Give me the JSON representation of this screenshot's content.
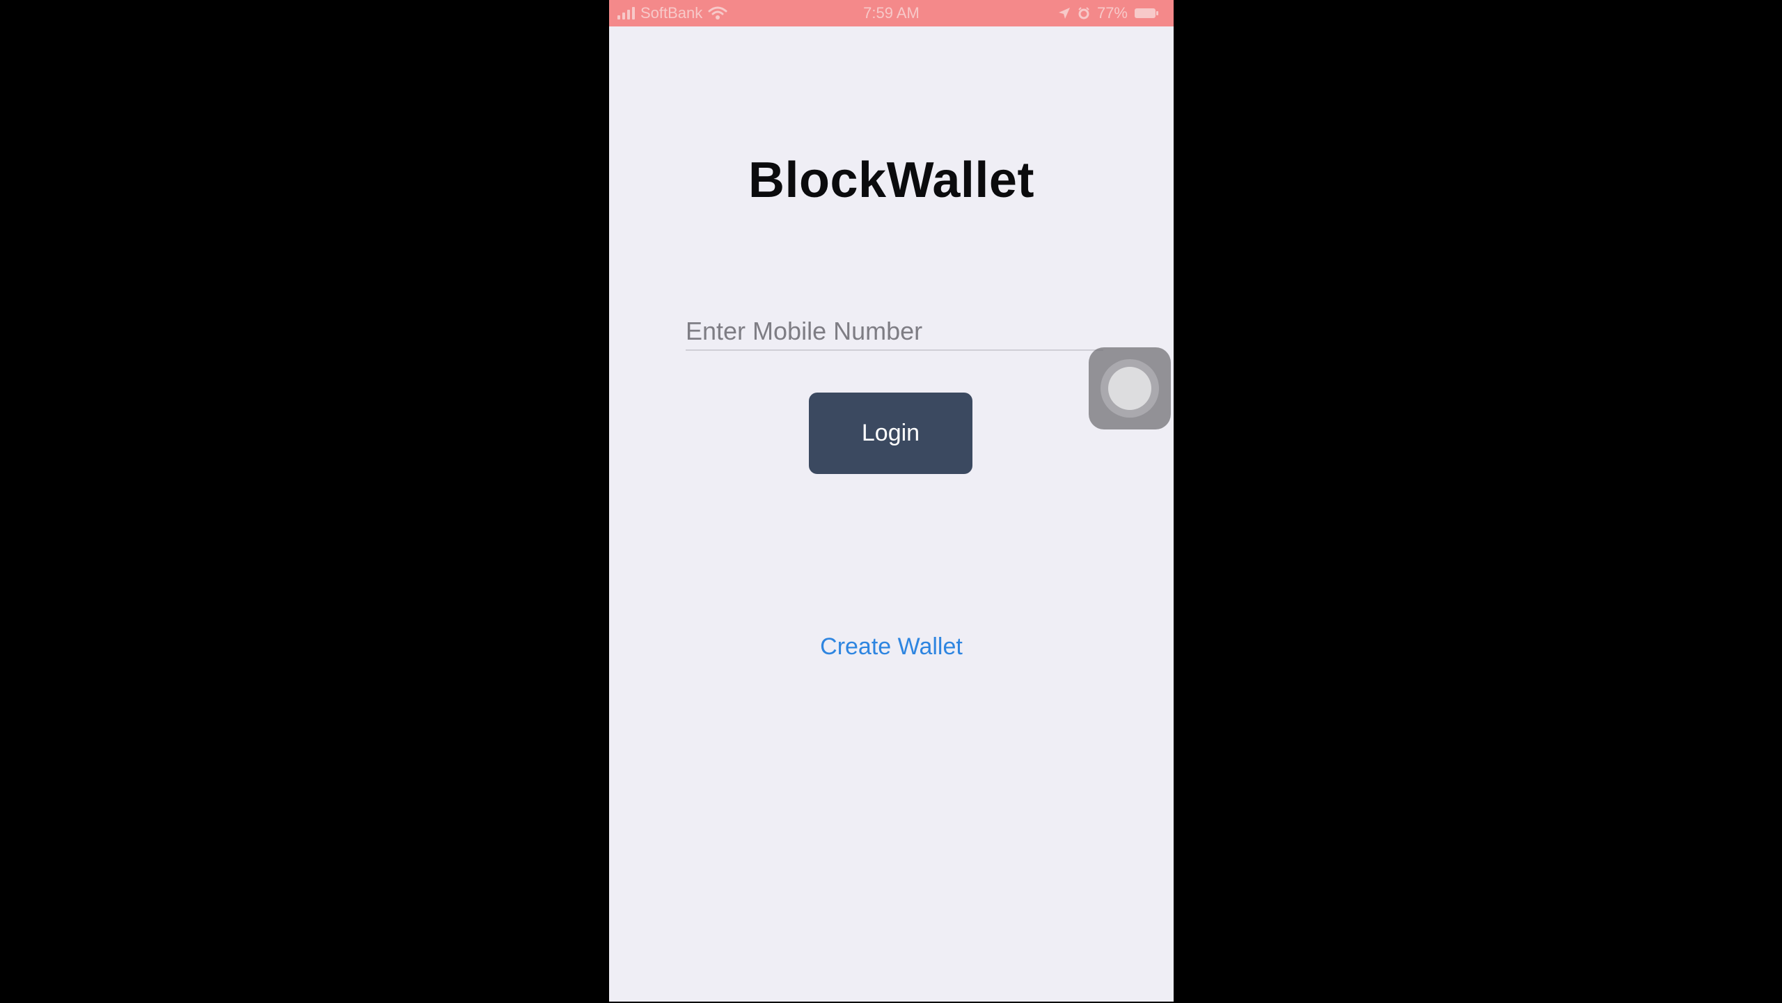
{
  "status_bar": {
    "carrier": "SoftBank",
    "time": "7:59 AM",
    "battery": "77%",
    "icons": [
      "signal-icon",
      "wifi-icon",
      "location-icon",
      "alarm-icon",
      "battery-icon"
    ]
  },
  "app": {
    "title": "BlockWallet"
  },
  "login_form": {
    "mobile_placeholder": "Enter Mobile Number",
    "mobile_value": "",
    "login_label": "Login",
    "create_wallet_label": "Create Wallet"
  },
  "colors": {
    "status_bar_bg": "#f4898a",
    "screen_bg": "#efeef5",
    "login_button_bg": "#3b4960",
    "link": "#2e85e0"
  }
}
